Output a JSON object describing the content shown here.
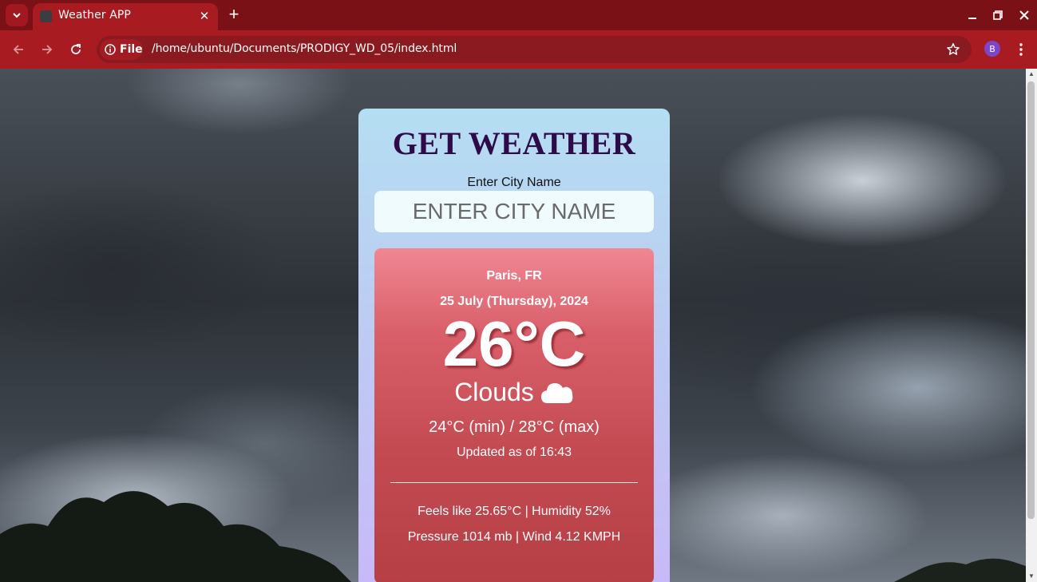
{
  "browser": {
    "tab_title": "Weather APP",
    "site_chip": "File",
    "url": "/home/ubuntu/Documents/PRODIGY_WD_05/index.html",
    "profile_initial": "B",
    "colors": {
      "frame": "#7a1116",
      "toolbar": "#a81c21",
      "profile": "#7b47c8"
    }
  },
  "app": {
    "title": "GET WEATHER",
    "city_label": "Enter City Name",
    "city_input": {
      "value": "",
      "placeholder": "ENTER CITY NAME"
    },
    "weather": {
      "location": "Paris, FR",
      "date": "25 July (Thursday), 2024",
      "temperature": "26°C",
      "condition": "Clouds",
      "condition_icon": "cloud-icon",
      "min_max": "24°C (min) / 28°C (max)",
      "updated": "Updated as of 16:43",
      "feels_humidity": "Feels like 25.65°C | Humidity 52%",
      "pressure_wind": "Pressure 1014 mb | Wind 4.12 KMPH"
    },
    "colors": {
      "title": "#2e0a49",
      "card_top": "#b4def2",
      "card_bottom": "#c9b8f8",
      "result_top": "#f08793",
      "result_bottom": "#b53f45"
    }
  }
}
